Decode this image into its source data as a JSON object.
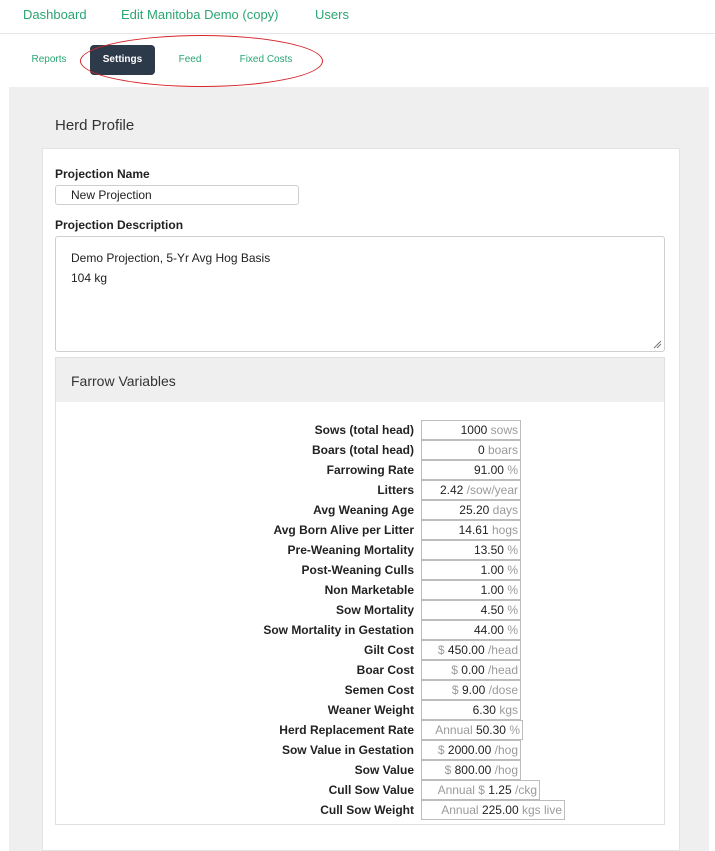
{
  "nav": {
    "dashboard": "Dashboard",
    "edit": "Edit Manitoba Demo (copy)",
    "users": "Users"
  },
  "tabs": [
    {
      "label": "Reports",
      "active": false
    },
    {
      "label": "Settings",
      "active": true
    },
    {
      "label": "Feed",
      "active": false
    },
    {
      "label": "Fixed Costs",
      "active": false
    }
  ],
  "panel": {
    "title": "Herd Profile",
    "projection_name_label": "Projection Name",
    "projection_name_value": "New Projection",
    "projection_description_label": "Projection Description",
    "projection_description_lines": [
      "Demo Projection, 5-Yr Avg Hog Basis",
      "104 kg"
    ]
  },
  "farrow": {
    "title": "Farrow Variables",
    "rows": [
      {
        "label": "Sows (total head)",
        "prefix": "",
        "value": "1000",
        "suffix": "sows"
      },
      {
        "label": "Boars (total head)",
        "prefix": "",
        "value": "0",
        "suffix": "boars"
      },
      {
        "label": "Farrowing Rate",
        "prefix": "",
        "value": "91.00",
        "suffix": "%"
      },
      {
        "label": "Litters",
        "prefix": "",
        "value": "2.42",
        "suffix": "/sow/year"
      },
      {
        "label": "Avg Weaning Age",
        "prefix": "",
        "value": "25.20",
        "suffix": "days"
      },
      {
        "label": "Avg Born Alive per Litter",
        "prefix": "",
        "value": "14.61",
        "suffix": "hogs"
      },
      {
        "label": "Pre-Weaning Mortality",
        "prefix": "",
        "value": "13.50",
        "suffix": "%"
      },
      {
        "label": "Post-Weaning Culls",
        "prefix": "",
        "value": "1.00",
        "suffix": "%"
      },
      {
        "label": "Non Marketable",
        "prefix": "",
        "value": "1.00",
        "suffix": "%"
      },
      {
        "label": "Sow Mortality",
        "prefix": "",
        "value": "4.50",
        "suffix": "%"
      },
      {
        "label": "Sow Mortality in Gestation",
        "prefix": "",
        "value": "44.00",
        "suffix": "%"
      },
      {
        "label": "Gilt Cost",
        "prefix": "$",
        "value": "450.00",
        "suffix": "/head"
      },
      {
        "label": "Boar Cost",
        "prefix": "$",
        "value": "0.00",
        "suffix": "/head"
      },
      {
        "label": "Semen Cost",
        "prefix": "$",
        "value": "9.00",
        "suffix": "/dose"
      },
      {
        "label": "Weaner Weight",
        "prefix": "",
        "value": "6.30",
        "suffix": "kgs"
      },
      {
        "label": "Herd Replacement Rate",
        "prefix": "Annual",
        "value": "50.30",
        "suffix": "%"
      },
      {
        "label": "Sow Value in Gestation",
        "prefix": "$",
        "value": "2000.00",
        "suffix": "/hog"
      },
      {
        "label": "Sow Value",
        "prefix": "$",
        "value": "800.00",
        "suffix": "/hog"
      },
      {
        "label": "Cull Sow Value",
        "prefix": "Annual $",
        "value": "1.25",
        "suffix": "/ckg"
      },
      {
        "label": "Cull Sow Weight",
        "prefix": "Annual",
        "value": "225.00",
        "suffix": "kgs live"
      }
    ]
  }
}
